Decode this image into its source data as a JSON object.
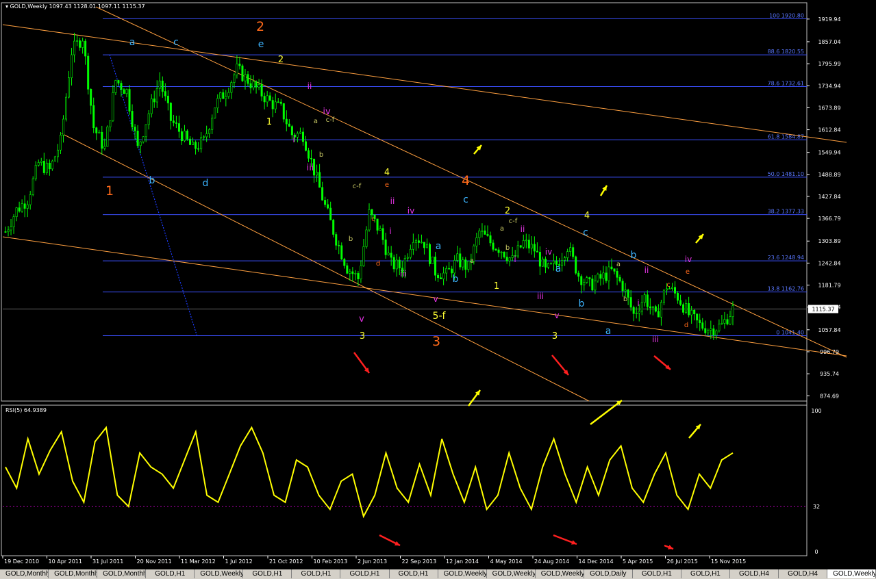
{
  "window": {
    "title_symbol": "GOLD,Weekly",
    "ohlc": "1097.43 1128.01 1097.11 1115.37"
  },
  "chart_data": [
    {
      "type": "line",
      "name": "GOLD Weekly price",
      "price_axis": {
        "min": 860,
        "max": 1950,
        "ticks": [
          "1919.94",
          "1857.04",
          "1795.99",
          "1734.94",
          "1673.89",
          "1612.84",
          "1549.94",
          "1488.89",
          "1427.84",
          "1366.79",
          "1303.89",
          "1242.84",
          "1181.79",
          "1120.74",
          "1057.84",
          "996.79",
          "935.74",
          "874.69"
        ]
      },
      "current_price": "1115.37",
      "x_axis": {
        "dates": [
          "19 Dec 2010",
          "10 Apr 2011",
          "31 Jul 2011",
          "20 Nov 2011",
          "11 Mar 2012",
          "1 Jul 2012",
          "21 Oct 2012",
          "10 Feb 2013",
          "2 Jun 2013",
          "22 Sep 2013",
          "12 Jan 2014",
          "4 May 2014",
          "24 Aug 2014",
          "14 Dec 2014",
          "5 Apr 2015",
          "26 Jul 2015",
          "15 Nov 2015"
        ]
      },
      "fibonacci_levels": [
        {
          "label": "100 1920.80",
          "price": 1920.8
        },
        {
          "label": "88.6 1820.55",
          "price": 1820.55
        },
        {
          "label": "78.6 1732.61",
          "price": 1732.61
        },
        {
          "label": "61.8 1584.87",
          "price": 1584.87
        },
        {
          "label": "50.0 1481.10",
          "price": 1481.1
        },
        {
          "label": "38.2 1377.33",
          "price": 1377.33
        },
        {
          "label": "23.6 1248.94",
          "price": 1248.94
        },
        {
          "label": "13.8 1162.76",
          "price": 1162.76
        },
        {
          "label": "0 1041.40",
          "price": 1041.4
        }
      ],
      "close_series": [
        1330,
        1390,
        1420,
        1520,
        1500,
        1580,
        1830,
        1870,
        1620,
        1560,
        1750,
        1720,
        1560,
        1660,
        1750,
        1640,
        1600,
        1560,
        1580,
        1680,
        1720,
        1780,
        1750,
        1720,
        1690,
        1670,
        1600,
        1600,
        1500,
        1400,
        1310,
        1230,
        1200,
        1380,
        1330,
        1240,
        1230,
        1320,
        1300,
        1220,
        1210,
        1250,
        1230,
        1330,
        1300,
        1280,
        1250,
        1300,
        1280,
        1220,
        1240,
        1290,
        1210,
        1180,
        1200,
        1220,
        1180,
        1100,
        1150,
        1090,
        1180,
        1150,
        1100,
        1070,
        1060,
        1070,
        1115
      ],
      "close_dates": [
        "2010-10",
        "2010-12",
        "2011-02",
        "2011-04",
        "2011-06",
        "2011-07",
        "2011-08",
        "2011-09",
        "2011-10",
        "2011-11",
        "2012-02",
        "2012-03",
        "2012-05",
        "2012-06",
        "2012-09",
        "2012-10",
        "2012-12",
        "2013-01",
        "2013-02",
        "2013-03",
        "2013-04",
        "2013-05",
        "2013-06",
        "2013-07",
        "2013-08",
        "2013-09",
        "2013-10",
        "2013-12",
        "2014-01",
        "2014-03",
        "2014-04",
        "2014-05",
        "2014-06",
        "2014-07",
        "2014-08",
        "2014-09",
        "2014-10",
        "2014-11",
        "2014-12",
        "2015-01",
        "2015-02",
        "2015-03",
        "2015-04",
        "2015-05",
        "2015-06",
        "2015-07",
        "2015-08",
        "2015-09",
        "2015-10",
        "2015-11",
        "2015-12",
        "2016-01"
      ]
    },
    {
      "type": "line",
      "name": "RSI",
      "header": "RSI(5) 64.9389",
      "y_ticks": [
        "100",
        "32",
        "0"
      ],
      "level": 32,
      "values": [
        60,
        45,
        80,
        55,
        72,
        85,
        50,
        35,
        78,
        88,
        40,
        32,
        70,
        60,
        55,
        45,
        65,
        85,
        40,
        35,
        55,
        75,
        88,
        70,
        40,
        35,
        65,
        60,
        40,
        30,
        50,
        55,
        25,
        40,
        70,
        45,
        35,
        62,
        40,
        80,
        55,
        35,
        60,
        30,
        40,
        70,
        45,
        30,
        60,
        80,
        55,
        35,
        60,
        40,
        65,
        75,
        45,
        35,
        55,
        70,
        40,
        30,
        55,
        45,
        65,
        70
      ]
    }
  ],
  "wave_labels": [
    {
      "text": "1",
      "color": "#ff6a1a"
    },
    {
      "text": "2",
      "color": "#ff6a1a"
    },
    {
      "text": "3",
      "color": "#ff6a1a"
    },
    {
      "text": "4",
      "color": "#ff6a1a"
    },
    {
      "text": "a",
      "color": "#3cb4ff"
    },
    {
      "text": "b",
      "color": "#3cb4ff"
    },
    {
      "text": "c",
      "color": "#3cb4ff"
    },
    {
      "text": "d",
      "color": "#3cb4ff"
    },
    {
      "text": "e",
      "color": "#3cb4ff"
    },
    {
      "text": "1",
      "color": "#ffff33"
    },
    {
      "text": "2",
      "color": "#ffff33"
    },
    {
      "text": "3",
      "color": "#ffff33"
    },
    {
      "text": "4",
      "color": "#ffff33"
    },
    {
      "text": "5-f",
      "color": "#ffff33"
    },
    {
      "text": "i",
      "color": "#e633e6"
    },
    {
      "text": "ii",
      "color": "#e633e6"
    },
    {
      "text": "iii",
      "color": "#e633e6"
    },
    {
      "text": "iv",
      "color": "#e633e6"
    },
    {
      "text": "v",
      "color": "#e633e6"
    },
    {
      "text": "a",
      "color": "#c8c864"
    },
    {
      "text": "b",
      "color": "#c8c864"
    },
    {
      "text": "c-f",
      "color": "#c8c864"
    },
    {
      "text": "c",
      "color": "#ff6a1a"
    },
    {
      "text": "d",
      "color": "#ff6a1a"
    },
    {
      "text": "e",
      "color": "#ff6a1a"
    }
  ],
  "tabs": [
    "GOLD,Monthly",
    "GOLD,Monthly",
    "GOLD,Monthly",
    "GOLD,H1",
    "GOLD,Weekly",
    "GOLD,H1",
    "GOLD,H1",
    "GOLD,H1",
    "GOLD,H1",
    "GOLD,Weekly",
    "GOLD,Weekly",
    "GOLD,Weekly",
    "GOLD,Daily",
    "GOLD,H1",
    "GOLD,H1",
    "GOLD,H4",
    "GOLD,H4",
    "GOLD,Weekly"
  ],
  "colors": {
    "candles": "#00ff00",
    "fib_lines": "#3c50ff",
    "trend_lines": "#ffa040",
    "rsi_line": "#ffff00",
    "arrow_up": "#ffff00",
    "arrow_down": "#ff2020",
    "axis": "#ffffff",
    "background": "#000000"
  }
}
